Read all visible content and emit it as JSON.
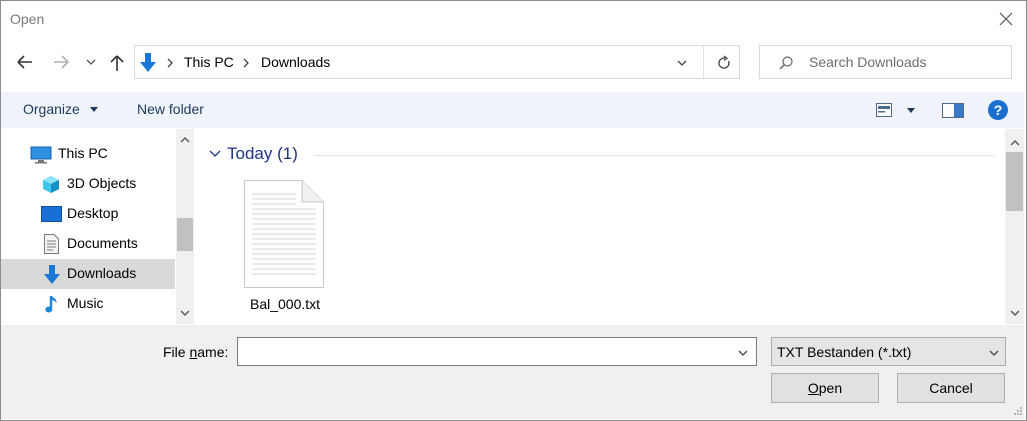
{
  "window": {
    "title": "Open"
  },
  "address_bar": {
    "breadcrumbs": [
      "This PC",
      "Downloads"
    ]
  },
  "search": {
    "placeholder": "Search Downloads"
  },
  "toolbar": {
    "organize_label": "Organize",
    "new_folder_label": "New folder"
  },
  "nav_pane": {
    "items": [
      {
        "label": "This PC",
        "icon": "computer-icon"
      },
      {
        "label": "3D Objects",
        "icon": "cube-icon"
      },
      {
        "label": "Desktop",
        "icon": "desktop-icon"
      },
      {
        "label": "Documents",
        "icon": "document-icon"
      },
      {
        "label": "Downloads",
        "icon": "download-arrow-icon",
        "selected": true
      },
      {
        "label": "Music",
        "icon": "music-note-icon"
      }
    ]
  },
  "content": {
    "group_label": "Today (1)",
    "files": [
      {
        "name": "Bal_000.txt",
        "icon": "text-file-icon"
      }
    ]
  },
  "bottom": {
    "file_name_label_prefix": "File ",
    "file_name_label_underline": "n",
    "file_name_label_suffix": "ame:",
    "file_name_value": "",
    "file_type_selected": "TXT Bestanden (*.txt)",
    "open_label_underline": "O",
    "open_label_rest": "pen",
    "cancel_label": "Cancel"
  },
  "colors": {
    "accent": "#0078d7",
    "group_text": "#1e3287",
    "selected_row": "#d9d9d9"
  }
}
